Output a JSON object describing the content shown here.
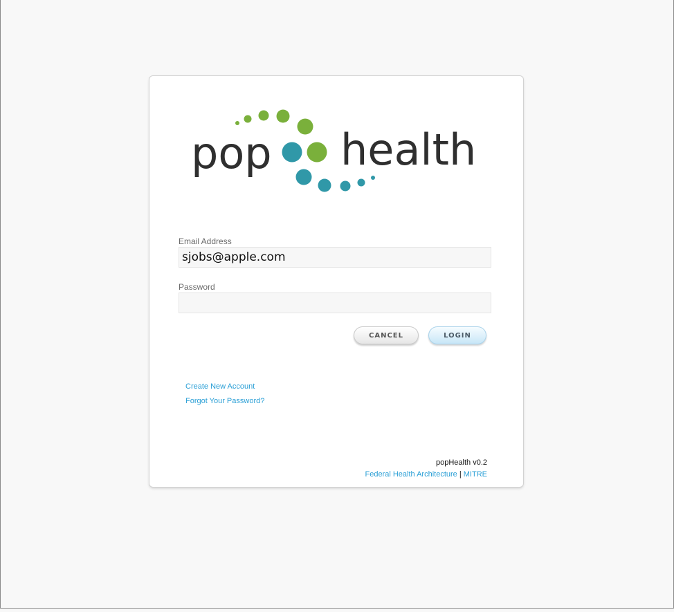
{
  "logo": {
    "left_word": "pop",
    "right_word": "health",
    "text_color": "#2f2f2f",
    "green": "#7ab03b",
    "teal": "#3098a8"
  },
  "form": {
    "email_label": "Email Address",
    "email_value": "sjobs@apple.com",
    "password_label": "Password",
    "password_value": "",
    "cancel_label": "CANCEL",
    "login_label": "LOGIN"
  },
  "links": {
    "create_account": "Create New Account",
    "forgot_password": "Forgot Your Password?"
  },
  "footer": {
    "version": "popHealth v0.2",
    "fha_link": "Federal Health Architecture",
    "separator": "|",
    "mitre_link": "MITRE",
    "link_color": "#2a9fd6"
  }
}
